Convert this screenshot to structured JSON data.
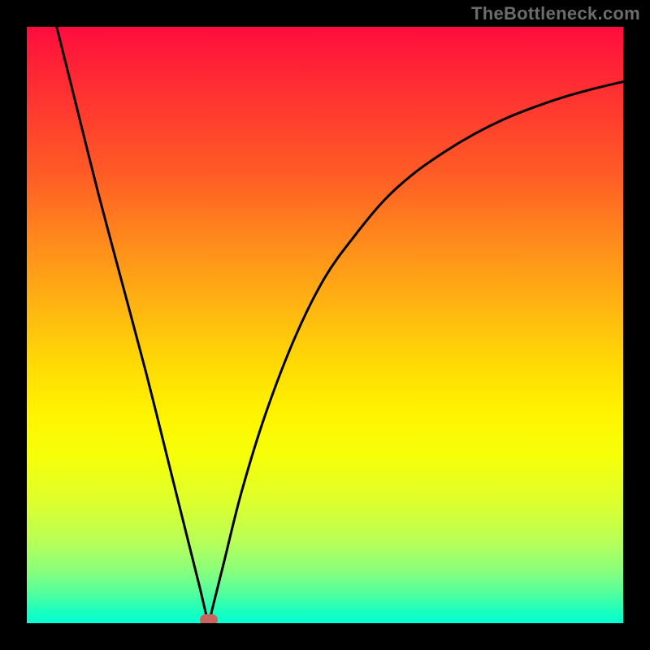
{
  "watermark": "TheBottleneck.com",
  "colors": {
    "frame": "#000000",
    "gradient_top": "#ff0c3e",
    "gradient_bottom": "#05ffd4",
    "curve": "#000000",
    "marker": "#c8645f"
  },
  "chart_data": {
    "type": "line",
    "title": "",
    "xlabel": "",
    "ylabel": "",
    "xlim": [
      0,
      100
    ],
    "ylim": [
      0,
      100
    ],
    "grid": false,
    "legend": false,
    "annotations": [],
    "marker": {
      "x": 30.5,
      "y": 0.3
    },
    "series": [
      {
        "name": "curve",
        "x": [
          5,
          8,
          12,
          16,
          20,
          24,
          27,
          29,
          30.5,
          31,
          33,
          36,
          40,
          45,
          50,
          55,
          60,
          65,
          70,
          75,
          80,
          85,
          90,
          95,
          100
        ],
        "values": [
          100,
          88,
          72,
          57,
          42,
          26,
          14,
          6,
          0,
          2,
          10,
          22,
          35,
          48,
          58,
          65,
          71,
          75.5,
          79,
          82,
          84.5,
          86.5,
          88.2,
          89.6,
          90.8
        ]
      }
    ],
    "background_gradient_stops": [
      {
        "pos": 0.0,
        "color": "#ff0c3e"
      },
      {
        "pos": 0.06,
        "color": "#ff2136"
      },
      {
        "pos": 0.14,
        "color": "#ff3a2f"
      },
      {
        "pos": 0.25,
        "color": "#ff5d25"
      },
      {
        "pos": 0.36,
        "color": "#ff8a1c"
      },
      {
        "pos": 0.47,
        "color": "#ffb511"
      },
      {
        "pos": 0.56,
        "color": "#ffd805"
      },
      {
        "pos": 0.65,
        "color": "#fff400"
      },
      {
        "pos": 0.72,
        "color": "#f6ff09"
      },
      {
        "pos": 0.8,
        "color": "#dcff2f"
      },
      {
        "pos": 0.86,
        "color": "#baff55"
      },
      {
        "pos": 0.91,
        "color": "#8cff7a"
      },
      {
        "pos": 0.95,
        "color": "#52ff9e"
      },
      {
        "pos": 0.98,
        "color": "#1affbe"
      },
      {
        "pos": 1.0,
        "color": "#05ffd4"
      }
    ]
  }
}
